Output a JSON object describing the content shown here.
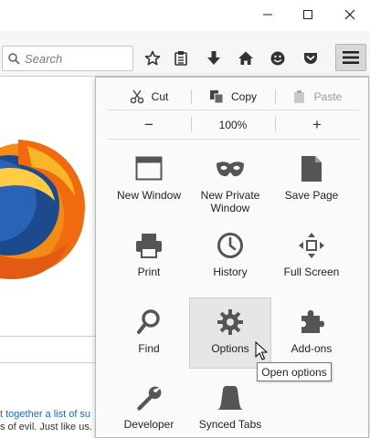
{
  "search": {
    "placeholder": "Search"
  },
  "menu": {
    "edit": {
      "cut": "Cut",
      "copy": "Copy",
      "paste": "Paste"
    },
    "zoom": {
      "minus": "−",
      "level": "100%",
      "plus": "+"
    },
    "items": {
      "new_window": "New Window",
      "new_private_line1": "New Private",
      "new_private_line2": "Window",
      "save_page": "Save Page",
      "print": "Print",
      "history": "History",
      "full_screen": "Full Screen",
      "find": "Find",
      "options": "Options",
      "addons": "Add-ons",
      "developer": "Developer",
      "synced_tabs": "Synced Tabs"
    },
    "tooltip": "Open options"
  },
  "page": {
    "link_text": "t together a list of su",
    "plain_text": "s of evil. Just like us."
  },
  "colors": {
    "icon_gray": "#5a5a5a",
    "firefox_orange": "#f07a12",
    "firefox_blue": "#1d4a8c"
  }
}
